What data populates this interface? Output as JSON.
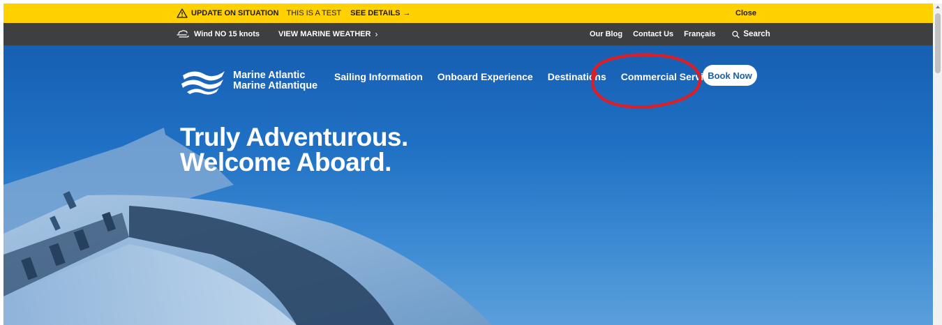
{
  "alert": {
    "title": "UPDATE ON SITUATION",
    "message": "THIS IS A TEST",
    "details_link": "SEE DETAILS",
    "arrow": "→",
    "close": "Close"
  },
  "utility": {
    "wind": "Wind NO 15 knots",
    "marine_weather": "VIEW MARINE WEATHER",
    "chevron": "›",
    "links": [
      "Our Blog",
      "Contact Us",
      "Français"
    ],
    "search": "Search"
  },
  "logo": {
    "line1": "Marine Atlantic",
    "line2": "Marine Atlantique"
  },
  "nav": {
    "items": [
      "Sailing Information",
      "Onboard Experience",
      "Destinations",
      "Commercial Services"
    ],
    "book_now": "Book Now"
  },
  "hero": {
    "line1": "Truly Adventurous.",
    "line2": "Welcome Aboard."
  },
  "colors": {
    "alert_bg": "#ffd100",
    "utility_bg": "#3d3f41",
    "hero_blue": "#1e6fc0",
    "annotation_red": "#d8202a"
  }
}
